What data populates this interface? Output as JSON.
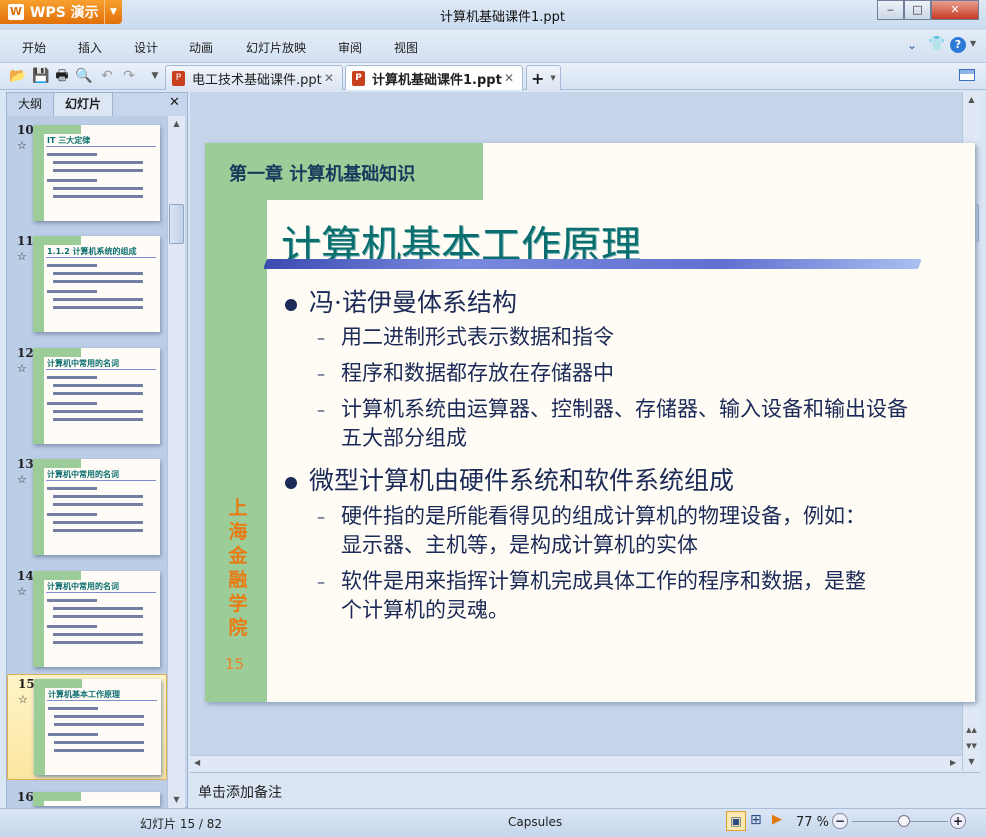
{
  "app": {
    "brand": "WPS 演示",
    "window_title": "计算机基础课件1.ppt"
  },
  "menu": [
    "开始",
    "插入",
    "设计",
    "动画",
    "幻灯片放映",
    "审阅",
    "视图"
  ],
  "doc_tabs": [
    {
      "label": "电工技术基础课件.ppt",
      "active": false
    },
    {
      "label": "计算机基础课件1.ppt",
      "active": true
    }
  ],
  "left_panel": {
    "tabs": [
      "大纲",
      "幻灯片"
    ],
    "active_tab": "幻灯片",
    "thumbnails": [
      {
        "number": "10",
        "title": "IT 三大定律"
      },
      {
        "number": "11",
        "title": "1.1.2 计算机系统的组成"
      },
      {
        "number": "12",
        "title": "计算机中常用的名词"
      },
      {
        "number": "13",
        "title": "计算机中常用的名词"
      },
      {
        "number": "14",
        "title": "计算机中常用的名词"
      },
      {
        "number": "15",
        "title": "计算机基本工作原理",
        "selected": true
      },
      {
        "number": "16",
        "title": ""
      }
    ]
  },
  "slide": {
    "chapter": "第一章  计算机基础知识",
    "title": "计算机基本工作原理",
    "school_chars": [
      "上",
      "海",
      "金",
      "融",
      "学",
      "院"
    ],
    "page_number": "15",
    "bullets": [
      {
        "text": "冯·诺伊曼体系结构",
        "sub": [
          "用二进制形式表示数据和指令",
          "程序和数据都存放在存储器中",
          "计算机系统由运算器、控制器、存储器、输入设备和输出设备五大部分组成"
        ]
      },
      {
        "text": "微型计算机由硬件系统和软件系统组成",
        "sub": [
          "硬件指的是所能看得见的组成计算机的物理设备，例如：显示器、主机等，是构成计算机的实体",
          "软件是用来指挥计算机完成具体工作的程序和数据，是整个计算机的灵魂。"
        ]
      }
    ]
  },
  "notes_placeholder": "单击添加备注",
  "status": {
    "slide_counter": "幻灯片 15 / 82",
    "theme": "Capsules",
    "zoom": "77 %",
    "zoom_percent": 77
  },
  "colors": {
    "accent_orange": "#e2700a",
    "slide_green": "#9ccc98",
    "title_teal": "#0b6e6e",
    "text_navy": "#1b2a56"
  }
}
